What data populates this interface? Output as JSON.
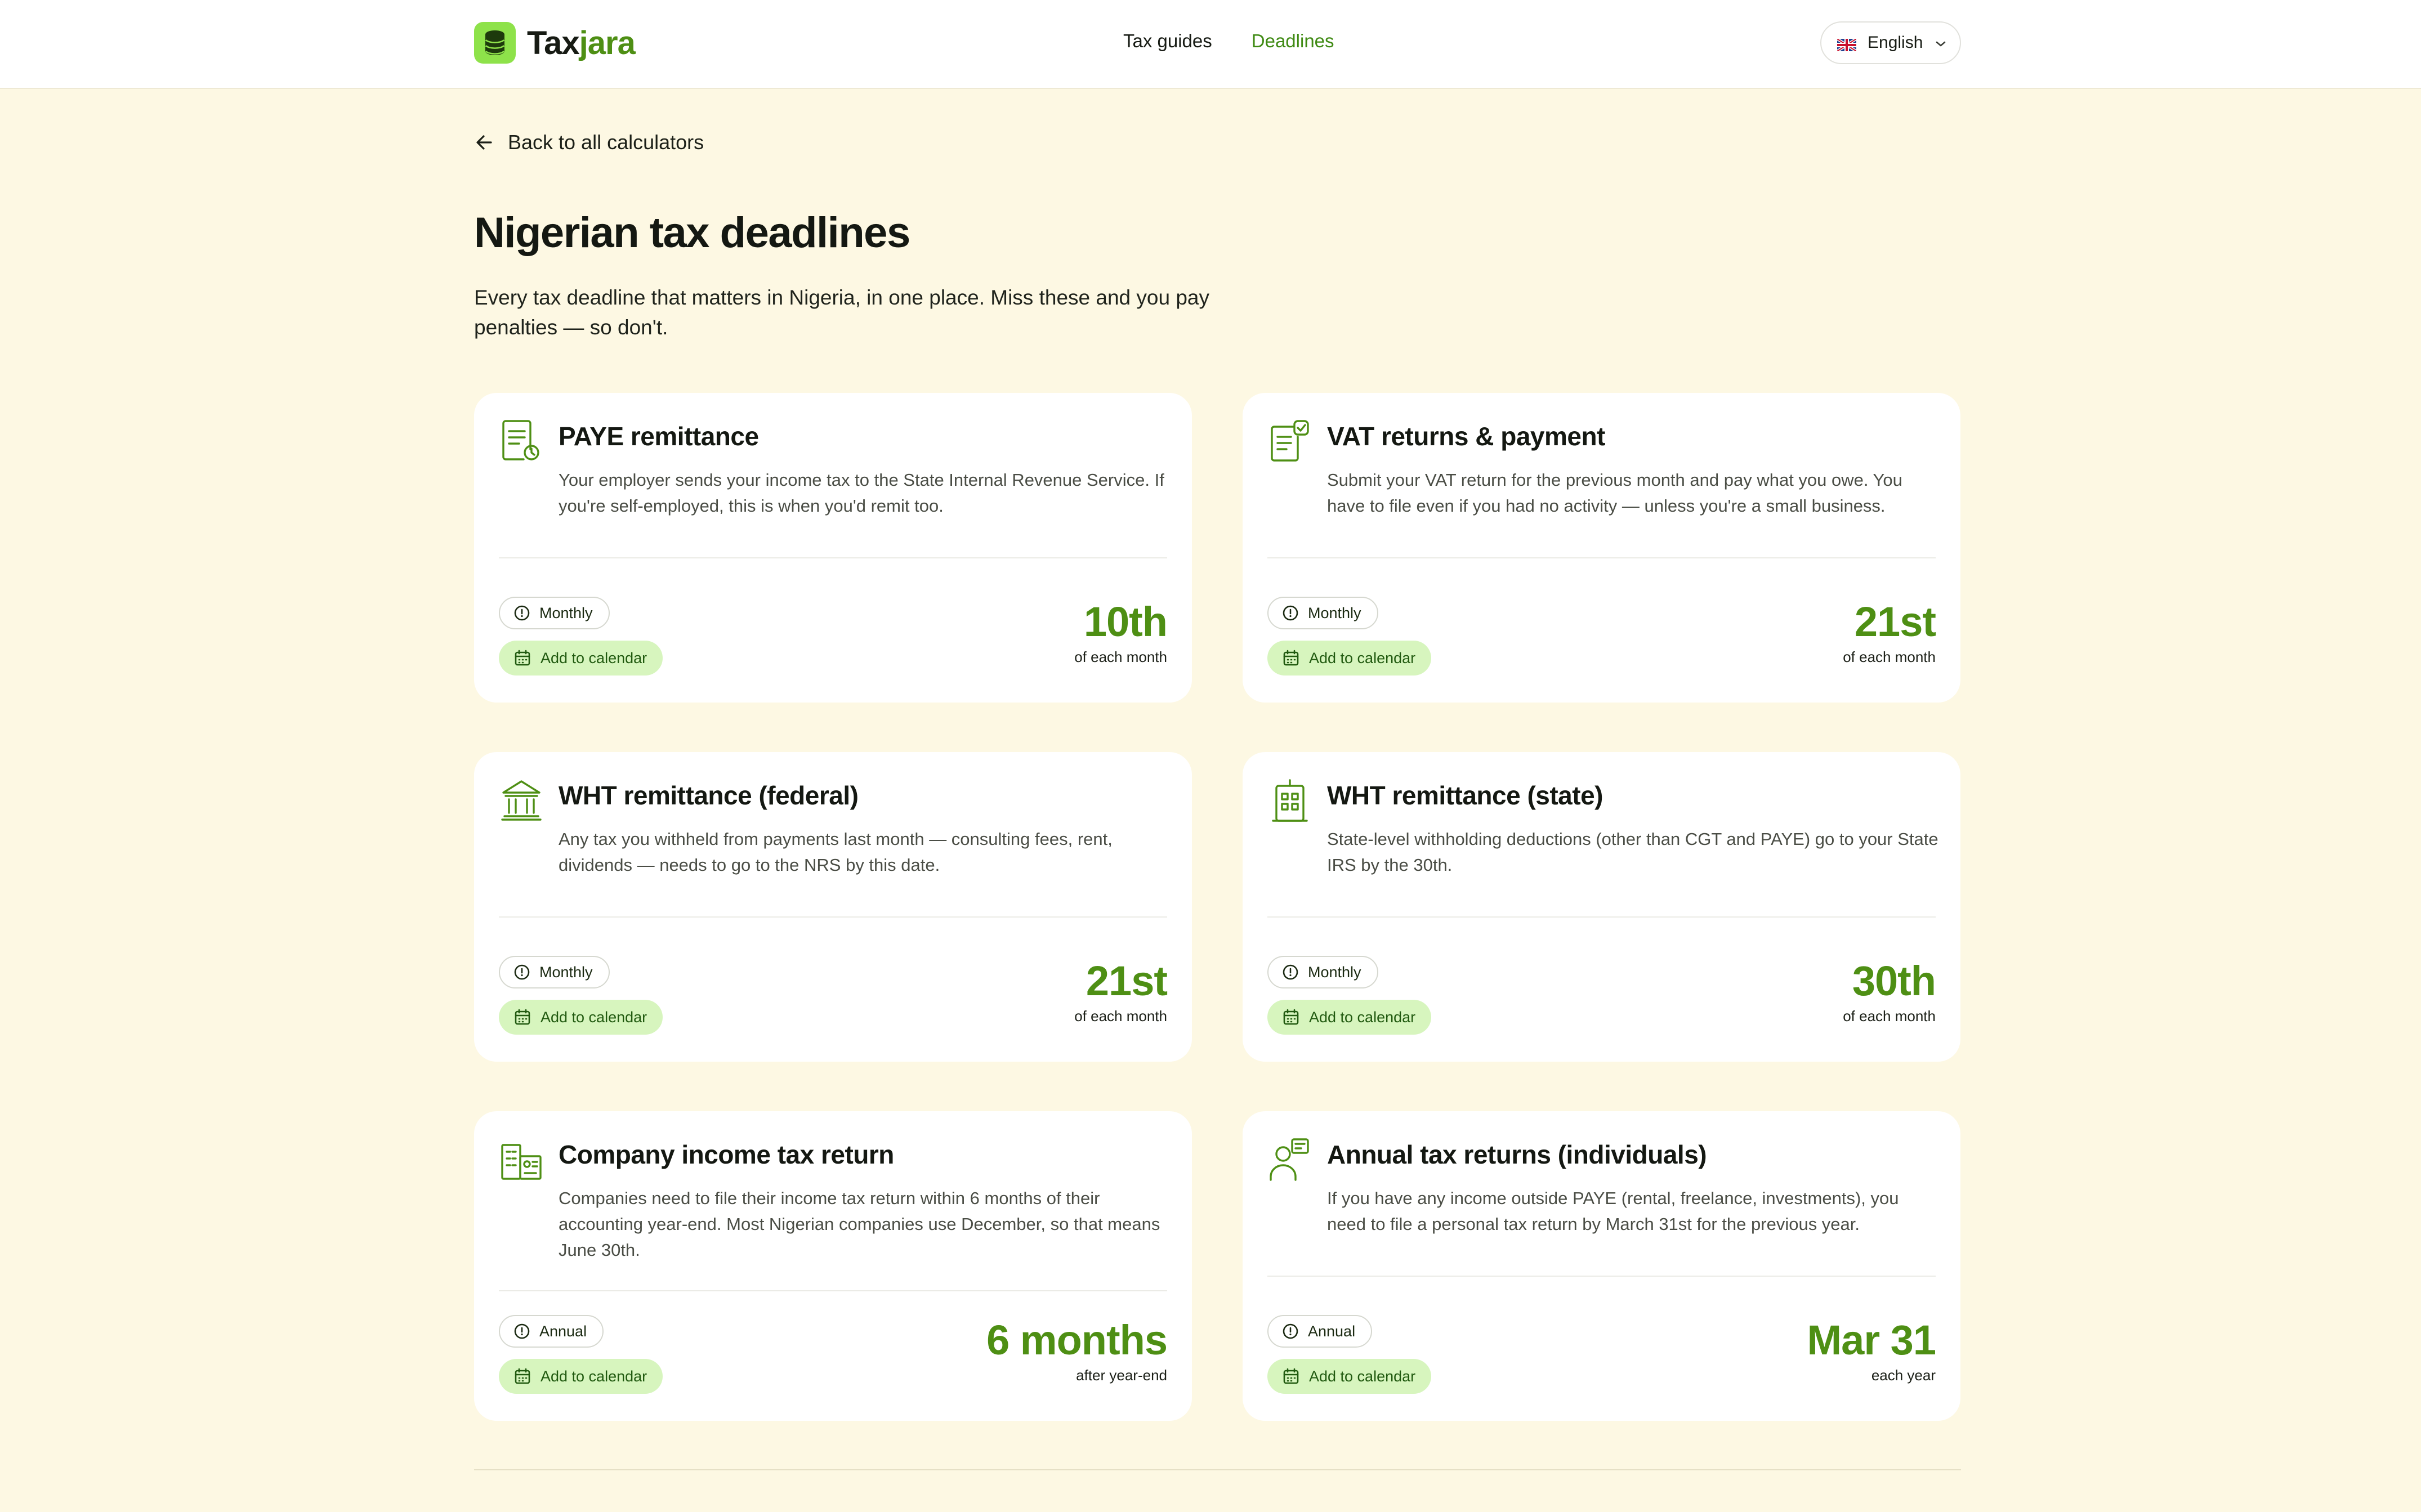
{
  "brand": {
    "name_prefix": "Tax",
    "name_suffix": "jara",
    "accent": "#4e8f14",
    "logo_bg": "#8ee24a"
  },
  "nav": {
    "items": [
      {
        "label": "Tax guides",
        "active": false
      },
      {
        "label": "Deadlines",
        "active": true
      }
    ]
  },
  "language": {
    "label": "English",
    "flag": "uk-flag-icon"
  },
  "back_link": "Back to all calculators",
  "page": {
    "title": "Nigerian tax deadlines",
    "subtitle": "Every tax deadline that matters in Nigeria, in one place. Miss these and you pay penalties — so don't."
  },
  "calendar_label": "Add to calendar",
  "cards": [
    {
      "icon": "document-clock-icon",
      "title": "PAYE remittance",
      "description": "Your employer sends your income tax to the State Internal Revenue Service. If you're self-employed, this is when you'd remit too.",
      "frequency": "Monthly",
      "value": "10th",
      "unit": "of each month"
    },
    {
      "icon": "document-check-icon",
      "title": "VAT returns & payment",
      "description": "Submit your VAT return for the previous month and pay what you owe. You have to file even if you had no activity — unless you're a small business.",
      "frequency": "Monthly",
      "value": "21st",
      "unit": "of each month"
    },
    {
      "icon": "bank-icon",
      "title": "WHT remittance (federal)",
      "description": "Any tax you withheld from payments last month — consulting fees, rent, dividends — needs to go to the NRS by this date.",
      "frequency": "Monthly",
      "value": "21st",
      "unit": "of each month"
    },
    {
      "icon": "state-building-icon",
      "title": "WHT remittance (state)",
      "description": "State-level withholding deductions (other than CGT and PAYE) go to your State IRS by the 30th.",
      "frequency": "Monthly",
      "value": "30th",
      "unit": "of each month"
    },
    {
      "icon": "company-building-icon",
      "title": "Company income tax return",
      "description": "Companies need to file their income tax return within 6 months of their accounting year-end. Most Nigerian companies use December, so that means June 30th.",
      "frequency": "Annual",
      "value": "6 months",
      "unit": "after year-end"
    },
    {
      "icon": "person-document-icon",
      "title": "Annual tax returns (individuals)",
      "description": "If you have any income outside PAYE (rental, freelance, investments), you need to file a personal tax return by March 31st for the previous year.",
      "frequency": "Annual",
      "value": "Mar 31",
      "unit": "each year"
    }
  ]
}
